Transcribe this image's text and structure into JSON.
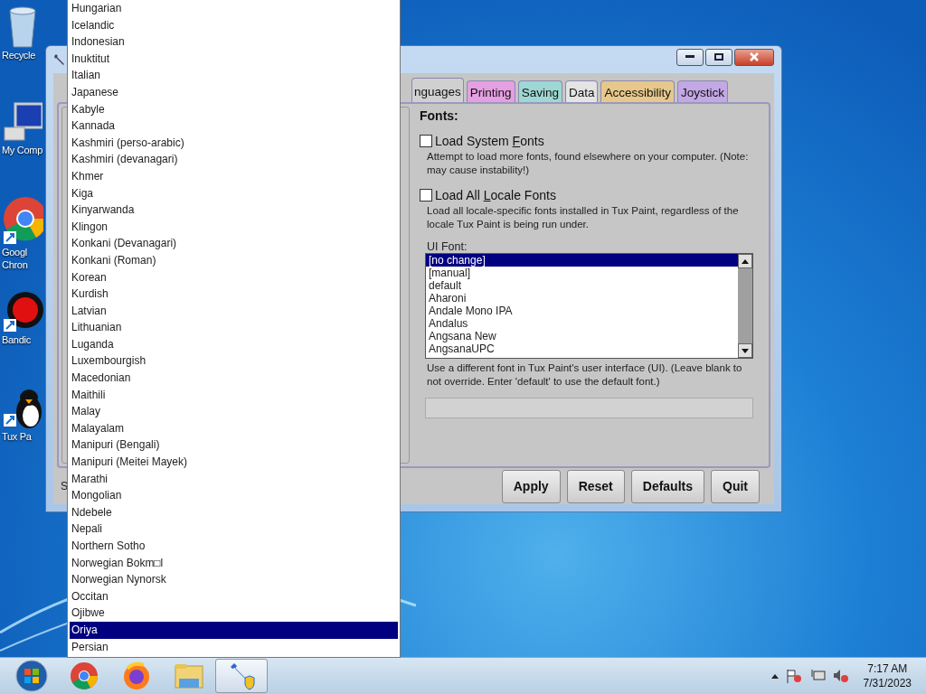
{
  "desktop_icons": [
    {
      "kind": "recycle",
      "lines": [
        "Recycle"
      ]
    },
    {
      "kind": "computer",
      "lines": [
        "My Comp"
      ]
    },
    {
      "kind": "chrome",
      "lines": [
        "Googl",
        "Chron"
      ]
    },
    {
      "kind": "record",
      "lines": [
        "Bandic"
      ]
    },
    {
      "kind": "penguin",
      "lines": [
        "Tux Pa"
      ]
    }
  ],
  "window": {
    "tabs": [
      {
        "label": "nguages",
        "selected": true,
        "color": "#d0d0d0"
      },
      {
        "label": "Printing",
        "selected": false,
        "color": "#e4a0e0"
      },
      {
        "label": "Saving",
        "selected": false,
        "color": "#9ed8d4"
      },
      {
        "label": "Data",
        "selected": false,
        "color": "#e4e4e4"
      },
      {
        "label": "Accessibility",
        "selected": false,
        "color": "#e6c88c"
      },
      {
        "label": "Joystick",
        "selected": false,
        "color": "#c2a8e4"
      }
    ],
    "fonts": {
      "heading": "Fonts:",
      "options": [
        {
          "label_parts": [
            "Load System ",
            "F",
            "onts"
          ],
          "checked": false,
          "description": "Attempt to load more fonts, found elsewhere on your computer. (Note: may cause instability!)"
        },
        {
          "label_parts": [
            "Load All ",
            "L",
            "ocale Fonts"
          ],
          "checked": false,
          "description": "Load all locale-specific fonts installed in Tux Paint, regardless of the locale Tux Paint is being run under."
        }
      ],
      "ui_font_label": "UI Font:",
      "ui_fonts": [
        {
          "label": "[no change]",
          "selected": true
        },
        {
          "label": "[manual]",
          "selected": false
        },
        {
          "label": "default",
          "selected": false
        },
        {
          "label": "Aharoni",
          "selected": false
        },
        {
          "label": "Andale Mono IPA",
          "selected": false
        },
        {
          "label": "Andalus",
          "selected": false
        },
        {
          "label": "Angsana New",
          "selected": false
        },
        {
          "label": "AngsanaUPC",
          "selected": false
        }
      ],
      "ui_font_help": "Use a different font in Tux Paint's user interface (UI). (Leave blank to not override. Enter 'default' to use the default font.)"
    },
    "footer_label": "S",
    "buttons": [
      "Apply",
      "Reset",
      "Defaults",
      "Quit"
    ]
  },
  "language_dropdown": [
    {
      "label": "Hungarian",
      "selected": false
    },
    {
      "label": "Icelandic",
      "selected": false
    },
    {
      "label": "Indonesian",
      "selected": false
    },
    {
      "label": "Inuktitut",
      "selected": false
    },
    {
      "label": "Italian",
      "selected": false
    },
    {
      "label": "Japanese",
      "selected": false
    },
    {
      "label": "Kabyle",
      "selected": false
    },
    {
      "label": "Kannada",
      "selected": false
    },
    {
      "label": "Kashmiri (perso-arabic)",
      "selected": false
    },
    {
      "label": "Kashmiri (devanagari)",
      "selected": false
    },
    {
      "label": "Khmer",
      "selected": false
    },
    {
      "label": "Kiga",
      "selected": false
    },
    {
      "label": "Kinyarwanda",
      "selected": false
    },
    {
      "label": "Klingon",
      "selected": false
    },
    {
      "label": "Konkani (Devanagari)",
      "selected": false
    },
    {
      "label": "Konkani (Roman)",
      "selected": false
    },
    {
      "label": "Korean",
      "selected": false
    },
    {
      "label": "Kurdish",
      "selected": false
    },
    {
      "label": "Latvian",
      "selected": false
    },
    {
      "label": "Lithuanian",
      "selected": false
    },
    {
      "label": "Luganda",
      "selected": false
    },
    {
      "label": "Luxembourgish",
      "selected": false
    },
    {
      "label": "Macedonian",
      "selected": false
    },
    {
      "label": "Maithili",
      "selected": false
    },
    {
      "label": "Malay",
      "selected": false
    },
    {
      "label": "Malayalam",
      "selected": false
    },
    {
      "label": "Manipuri (Bengali)",
      "selected": false
    },
    {
      "label": "Manipuri (Meitei Mayek)",
      "selected": false
    },
    {
      "label": "Marathi",
      "selected": false
    },
    {
      "label": "Mongolian",
      "selected": false
    },
    {
      "label": "Ndebele",
      "selected": false
    },
    {
      "label": "Nepali",
      "selected": false
    },
    {
      "label": "Northern Sotho",
      "selected": false
    },
    {
      "label": "Norwegian Bokm□l",
      "selected": false
    },
    {
      "label": "Norwegian Nynorsk",
      "selected": false
    },
    {
      "label": "Occitan",
      "selected": false
    },
    {
      "label": "Ojibwe",
      "selected": false
    },
    {
      "label": "Oriya",
      "selected": true
    },
    {
      "label": "Persian",
      "selected": false
    }
  ],
  "taskbar": {
    "apps": [
      {
        "kind": "chrome",
        "active": false
      },
      {
        "kind": "firefox",
        "active": false
      },
      {
        "kind": "folder",
        "active": false
      },
      {
        "kind": "wrench",
        "active": true
      }
    ],
    "time": "7:17 AM",
    "date": "7/31/2023"
  }
}
